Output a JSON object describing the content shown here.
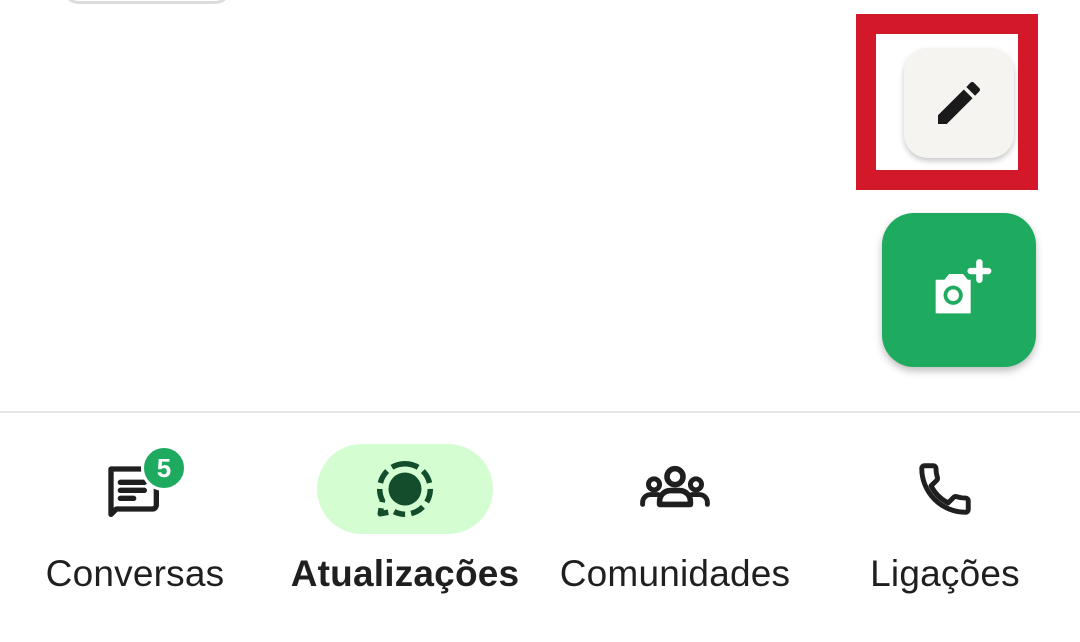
{
  "colors": {
    "accent_green": "#1fab5f",
    "active_pill": "#d5fdd2",
    "highlight_red": "#d3182a",
    "edit_fab_bg": "#f5f4f1",
    "text": "#1f1f1f"
  },
  "fabs": {
    "edit": {
      "icon": "pencil-icon"
    },
    "camera": {
      "icon": "camera-plus-icon"
    }
  },
  "bottom_nav": {
    "items": [
      {
        "label": "Conversas",
        "icon": "chat-list-icon",
        "badge": "5",
        "active": false
      },
      {
        "label": "Atualizações",
        "icon": "status-icon",
        "active": true
      },
      {
        "label": "Comunidades",
        "icon": "communities-icon",
        "active": false
      },
      {
        "label": "Ligações",
        "icon": "phone-icon",
        "active": false
      }
    ]
  }
}
